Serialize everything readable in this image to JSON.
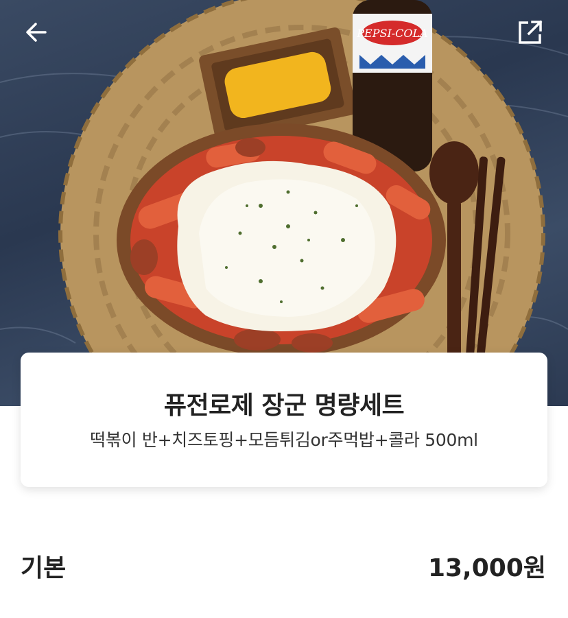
{
  "header": {
    "back_icon": "arrow-left-icon",
    "share_icon": "share-external-icon"
  },
  "hero": {
    "bottle_label": "PEPSI-COLA"
  },
  "product": {
    "title": "퓨전로제 장군 명량세트",
    "description": "떡볶이 반+치즈토핑+모듬튀김or주먹밥+콜라 500ml"
  },
  "price": {
    "label": "기본",
    "value": "13,000원"
  },
  "colors": {
    "text": "#222222",
    "background": "#ffffff"
  }
}
